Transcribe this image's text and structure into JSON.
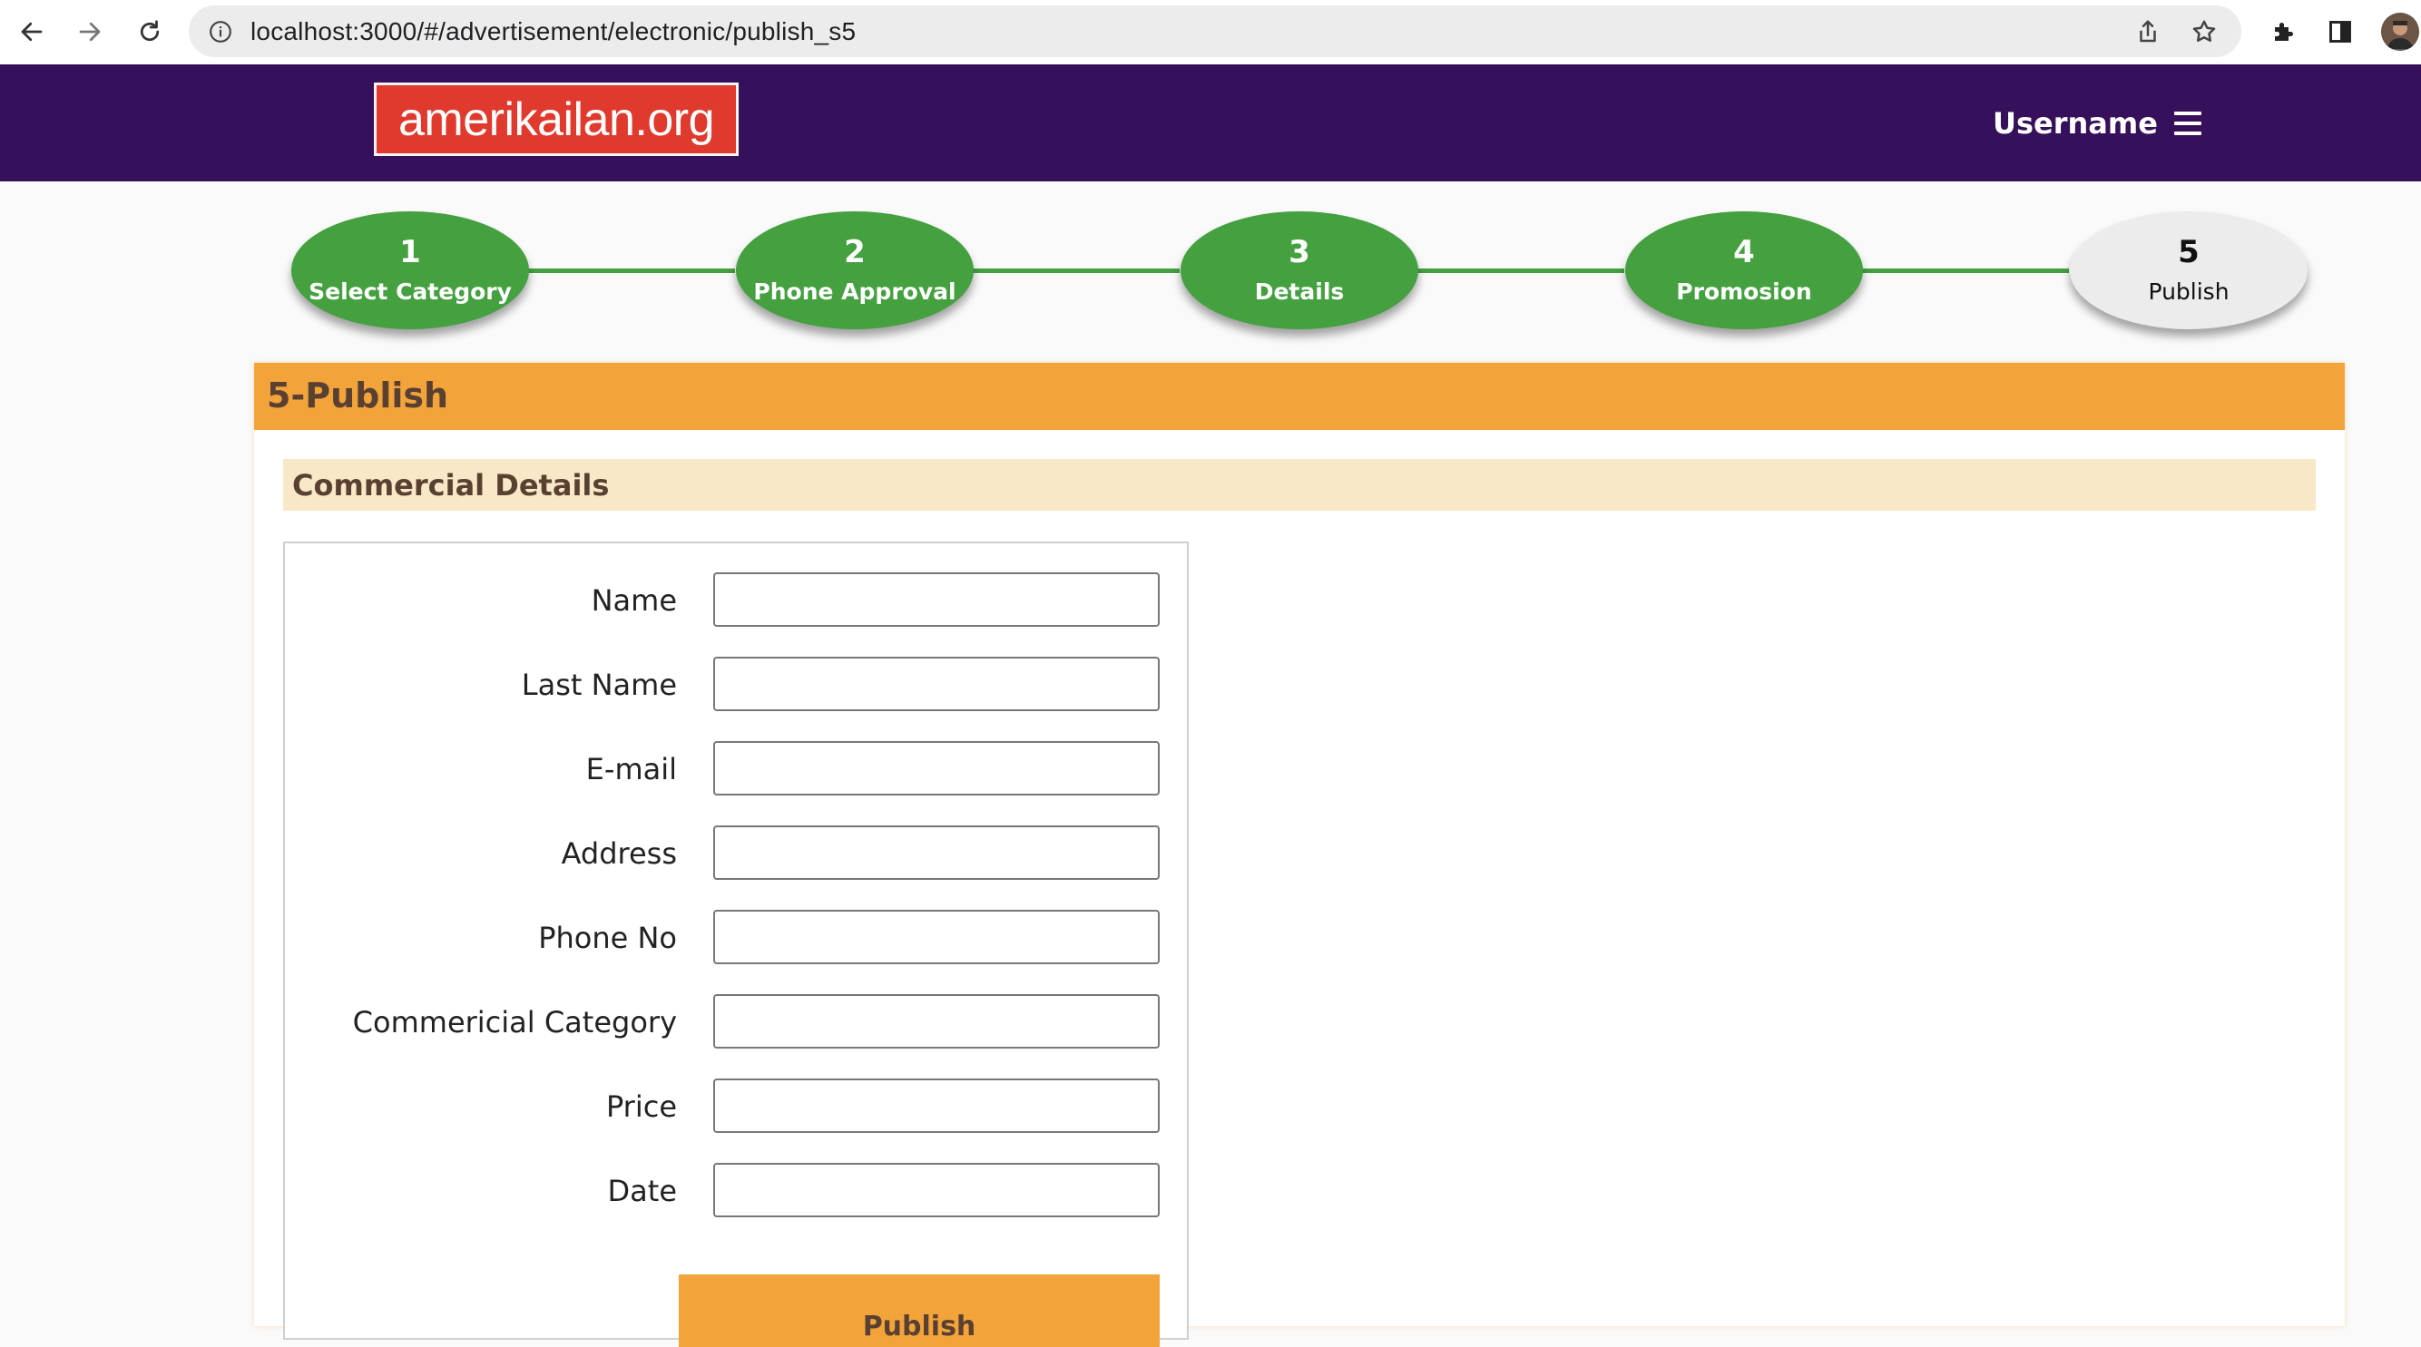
{
  "browser": {
    "url": "localhost:3000/#/advertisement/electronic/publish_s5"
  },
  "header": {
    "logo_text": "amerikailan.org",
    "username": "Username"
  },
  "stepper": {
    "steps": [
      {
        "number": "1",
        "label": "Select Category",
        "status": "done"
      },
      {
        "number": "2",
        "label": "Phone Approval",
        "status": "done"
      },
      {
        "number": "3",
        "label": "Details",
        "status": "done"
      },
      {
        "number": "4",
        "label": "Promosion",
        "status": "done"
      },
      {
        "number": "5",
        "label": "Publish",
        "status": "current"
      }
    ]
  },
  "main": {
    "panel_title": "5-Publish",
    "section_title": "Commercial Details",
    "form": {
      "fields": [
        {
          "label": "Name",
          "value": ""
        },
        {
          "label": "Last Name",
          "value": ""
        },
        {
          "label": "E-mail",
          "value": ""
        },
        {
          "label": "Address",
          "value": ""
        },
        {
          "label": "Phone No",
          "value": ""
        },
        {
          "label": "Commericial Category",
          "value": ""
        },
        {
          "label": "Price",
          "value": ""
        },
        {
          "label": "Date",
          "value": ""
        }
      ],
      "submit_label": "Publish"
    }
  },
  "colors": {
    "header_bg": "#36105b",
    "logo_bg": "#e03a2e",
    "step_done": "#45a040",
    "step_current": "#ececec",
    "accent_orange": "#f2a43b",
    "section_bg": "#f8e8c8",
    "heading_text": "#5a4030"
  }
}
